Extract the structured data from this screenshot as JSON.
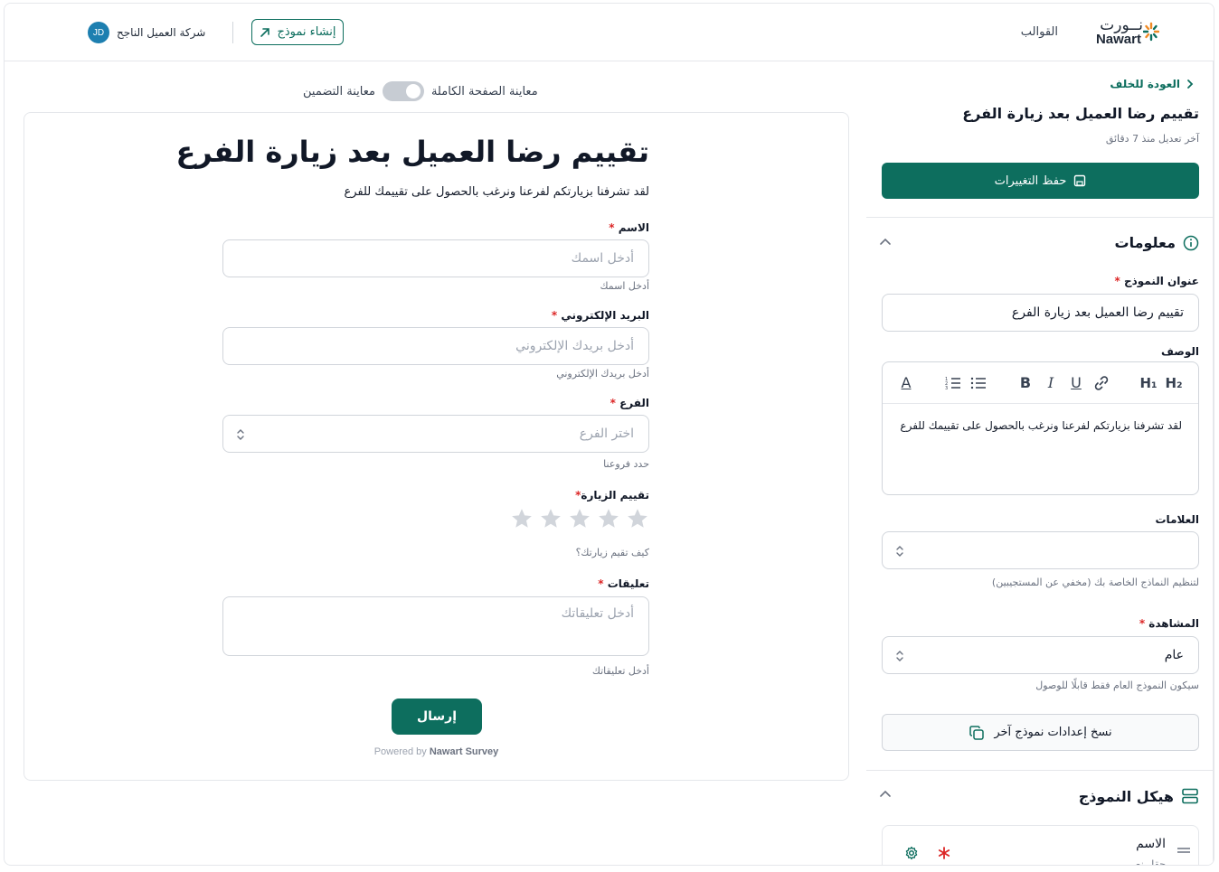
{
  "header": {
    "logo_ar": "نــورت",
    "logo_en": "Nawart",
    "nav_templates": "القوالب",
    "create_form": "إنشاء نموذج",
    "user_initials": "JD",
    "user_company": "شركة العميل الناجح"
  },
  "preview": {
    "toggle_full": "معاينة الصفحة الكاملة",
    "toggle_embed": "معاينة التضمين",
    "title": "تقييم رضا العميل بعد زيارة الفرع",
    "description": "لقد تشرفنا بزيارتكم لفرعنا ونرغب بالحصول على تقييمك للفرع",
    "fields": [
      {
        "label": "الاسم",
        "required": "*",
        "placeholder": "أدخل اسمك",
        "hint": "أدخل اسمك"
      },
      {
        "label": "البريد الإلكتروني",
        "required": "*",
        "placeholder": "أدخل بريدك الإلكتروني",
        "hint": "أدخل بريدك الإلكتروني"
      },
      {
        "label": "الفرع",
        "required": "*",
        "placeholder": "اختر الفرع",
        "hint": "حدد فروعنا"
      },
      {
        "label": "تقييم الزيارة",
        "required": "*",
        "hint": "كيف تقيم زيارتك؟"
      },
      {
        "label": "تعليقات",
        "required": "*",
        "placeholder": "أدخل تعليقاتك",
        "hint": "أدخل تعليقاتك"
      }
    ],
    "rating_value": 0,
    "rating_max": 5,
    "submit": "إرسال",
    "powered_prefix": "Powered by",
    "powered_brand": "Nawart Survey"
  },
  "sidebar": {
    "back": "العودة للخلف",
    "title": "تقييم رضا العميل بعد زيارة الفرع",
    "last_edit": "آخر تعديل منذ 7 دقائق",
    "save": "حفظ التغييرات",
    "info_heading": "معلومات",
    "form_title_label": "عنوان النموذج",
    "form_title_value": "تقييم رضا العميل بعد زيارة الفرع",
    "description_label": "الوصف",
    "description_value": "لقد تشرفنا بزيارتكم لفرعنا ونرغب بالحصول على تقييمك للفرع",
    "tags_label": "العلامات",
    "tags_hint": "لتنظيم النماذج الخاصة بك (مخفي عن المستجيبين)",
    "visibility_label": "المشاهدة",
    "visibility_value": "عام",
    "visibility_hint": "سيكون النموذج العام فقط قابلًا للوصول",
    "copy_settings": "نسخ إعدادات نموذج آخر",
    "structure_heading": "هيكل النموذج",
    "structure_items": [
      {
        "label": "الاسم",
        "type": "حقل نصي"
      }
    ],
    "required_mark": "*"
  },
  "colors": {
    "brand": "#0d6e5e",
    "required": "#dc2626",
    "avatar": "#1d7fb0"
  }
}
